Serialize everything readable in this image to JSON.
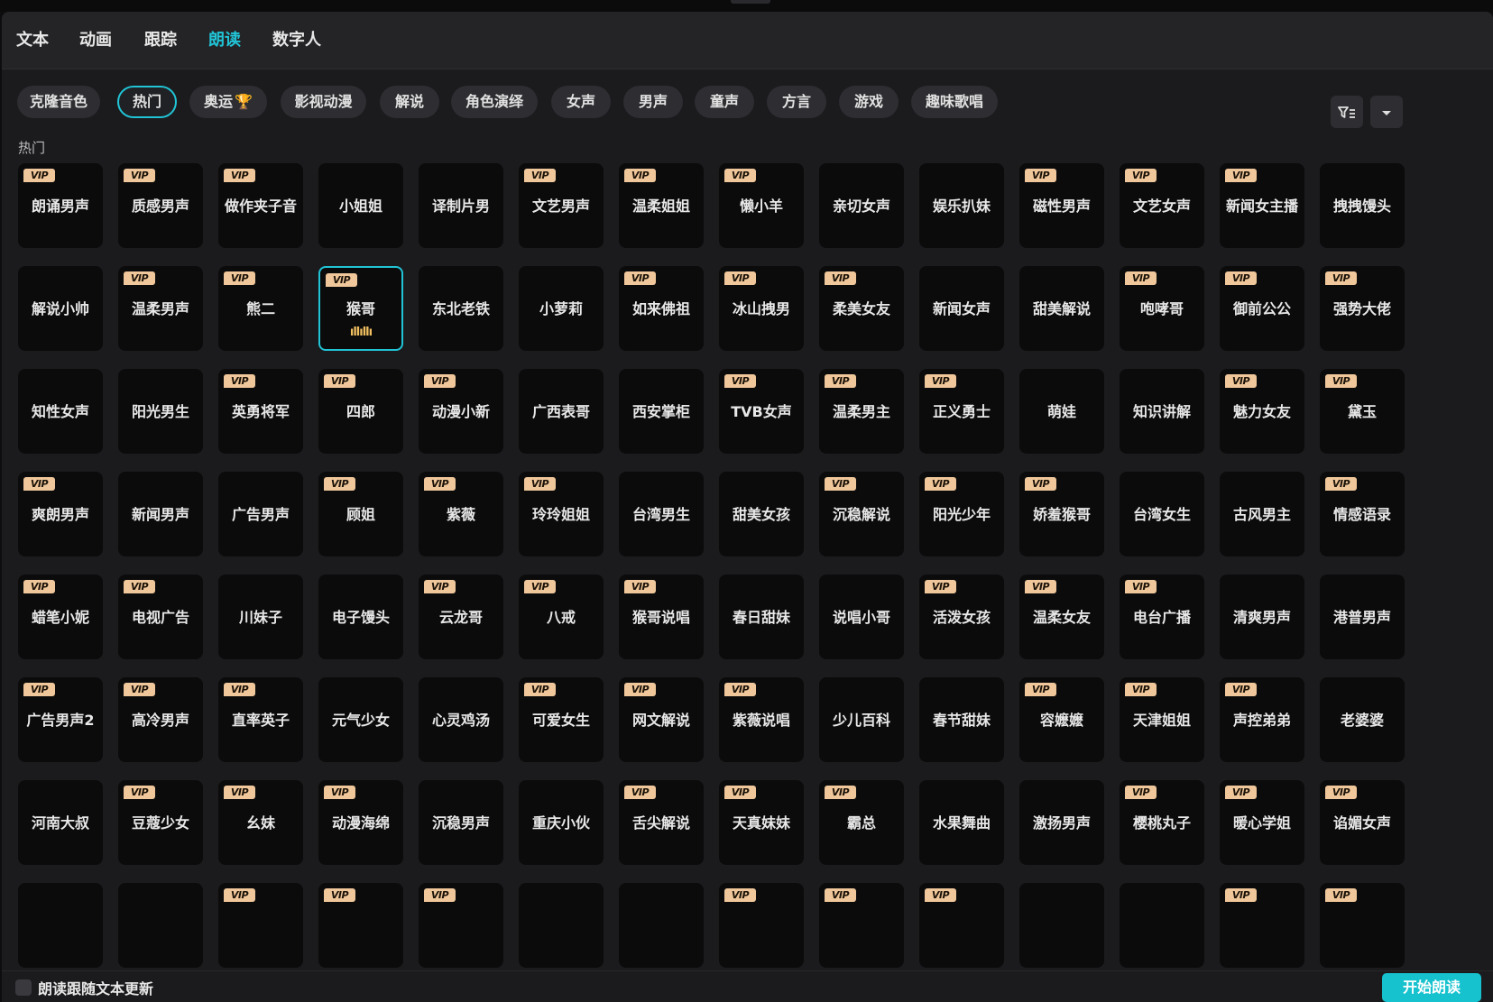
{
  "tabs": [
    "文本",
    "动画",
    "跟踪",
    "朗读",
    "数字人"
  ],
  "active_tab": "朗读",
  "filters": [
    {
      "label": "克隆音色"
    },
    {
      "label": "热门",
      "active": true
    },
    {
      "label": "奥运",
      "icon": "trophy-icon"
    },
    {
      "label": "影视动漫"
    },
    {
      "label": "解说"
    },
    {
      "label": "角色演绎"
    },
    {
      "label": "女声"
    },
    {
      "label": "男声"
    },
    {
      "label": "童声"
    },
    {
      "label": "方言"
    },
    {
      "label": "游戏"
    },
    {
      "label": "趣味歌唱"
    }
  ],
  "filter_button_icon": "filter-sort-icon",
  "expand_button_icon": "chevron-down-icon",
  "section_title": "热门",
  "vip_label": "VIP",
  "playing_wave": "ıllıllı",
  "voices": [
    [
      {
        "n": "朗诵男声",
        "v": true
      },
      {
        "n": "质感男声",
        "v": true
      },
      {
        "n": "做作夹子音",
        "v": true
      },
      {
        "n": "小姐姐",
        "v": false
      },
      {
        "n": "译制片男",
        "v": false
      },
      {
        "n": "文艺男声",
        "v": true
      },
      {
        "n": "温柔姐姐",
        "v": true
      },
      {
        "n": "懒小羊",
        "v": true
      },
      {
        "n": "亲切女声",
        "v": false
      },
      {
        "n": "娱乐扒妹",
        "v": false
      },
      {
        "n": "磁性男声",
        "v": true
      },
      {
        "n": "文艺女声",
        "v": true
      },
      {
        "n": "新闻女主播",
        "v": true
      },
      {
        "n": "拽拽馒头",
        "v": false
      }
    ],
    [
      {
        "n": "解说小帅",
        "v": false
      },
      {
        "n": "温柔男声",
        "v": true
      },
      {
        "n": "熊二",
        "v": true
      },
      {
        "n": "猴哥",
        "v": true,
        "selected": true
      },
      {
        "n": "东北老铁",
        "v": false
      },
      {
        "n": "小萝莉",
        "v": false
      },
      {
        "n": "如来佛祖",
        "v": true
      },
      {
        "n": "冰山拽男",
        "v": true
      },
      {
        "n": "柔美女友",
        "v": true
      },
      {
        "n": "新闻女声",
        "v": false
      },
      {
        "n": "甜美解说",
        "v": false
      },
      {
        "n": "咆哮哥",
        "v": true
      },
      {
        "n": "御前公公",
        "v": true
      },
      {
        "n": "强势大佬",
        "v": true
      }
    ],
    [
      {
        "n": "知性女声",
        "v": false
      },
      {
        "n": "阳光男生",
        "v": false
      },
      {
        "n": "英勇将军",
        "v": true
      },
      {
        "n": "四郎",
        "v": true
      },
      {
        "n": "动漫小新",
        "v": true
      },
      {
        "n": "广西表哥",
        "v": false
      },
      {
        "n": "西安掌柜",
        "v": false
      },
      {
        "n": "TVB女声",
        "v": true
      },
      {
        "n": "温柔男主",
        "v": true
      },
      {
        "n": "正义勇士",
        "v": true
      },
      {
        "n": "萌娃",
        "v": false
      },
      {
        "n": "知识讲解",
        "v": false
      },
      {
        "n": "魅力女友",
        "v": true
      },
      {
        "n": "黛玉",
        "v": true
      }
    ],
    [
      {
        "n": "爽朗男声",
        "v": true
      },
      {
        "n": "新闻男声",
        "v": false
      },
      {
        "n": "广告男声",
        "v": false
      },
      {
        "n": "顾姐",
        "v": true
      },
      {
        "n": "紫薇",
        "v": true
      },
      {
        "n": "玲玲姐姐",
        "v": true
      },
      {
        "n": "台湾男生",
        "v": false
      },
      {
        "n": "甜美女孩",
        "v": false
      },
      {
        "n": "沉稳解说",
        "v": true
      },
      {
        "n": "阳光少年",
        "v": true
      },
      {
        "n": "娇羞猴哥",
        "v": true
      },
      {
        "n": "台湾女生",
        "v": false
      },
      {
        "n": "古风男主",
        "v": false
      },
      {
        "n": "情感语录",
        "v": true
      }
    ],
    [
      {
        "n": "蜡笔小妮",
        "v": true
      },
      {
        "n": "电视广告",
        "v": true
      },
      {
        "n": "川妹子",
        "v": false
      },
      {
        "n": "电子馒头",
        "v": false
      },
      {
        "n": "云龙哥",
        "v": true
      },
      {
        "n": "八戒",
        "v": true
      },
      {
        "n": "猴哥说唱",
        "v": true
      },
      {
        "n": "春日甜妹",
        "v": false
      },
      {
        "n": "说唱小哥",
        "v": false
      },
      {
        "n": "活泼女孩",
        "v": true
      },
      {
        "n": "温柔女友",
        "v": true
      },
      {
        "n": "电台广播",
        "v": true
      },
      {
        "n": "清爽男声",
        "v": false
      },
      {
        "n": "港普男声",
        "v": false
      }
    ],
    [
      {
        "n": "广告男声2",
        "v": true
      },
      {
        "n": "高冷男声",
        "v": true
      },
      {
        "n": "直率英子",
        "v": true
      },
      {
        "n": "元气少女",
        "v": false
      },
      {
        "n": "心灵鸡汤",
        "v": false
      },
      {
        "n": "可爱女生",
        "v": true
      },
      {
        "n": "网文解说",
        "v": true
      },
      {
        "n": "紫薇说唱",
        "v": true
      },
      {
        "n": "少儿百科",
        "v": false
      },
      {
        "n": "春节甜妹",
        "v": false
      },
      {
        "n": "容嬷嬷",
        "v": true
      },
      {
        "n": "天津姐姐",
        "v": true
      },
      {
        "n": "声控弟弟",
        "v": true
      },
      {
        "n": "老婆婆",
        "v": false
      }
    ],
    [
      {
        "n": "河南大叔",
        "v": false
      },
      {
        "n": "豆蔻少女",
        "v": true
      },
      {
        "n": "幺妹",
        "v": true
      },
      {
        "n": "动漫海绵",
        "v": true
      },
      {
        "n": "沉稳男声",
        "v": false
      },
      {
        "n": "重庆小伙",
        "v": false
      },
      {
        "n": "舌尖解说",
        "v": true
      },
      {
        "n": "天真妹妹",
        "v": true
      },
      {
        "n": "霸总",
        "v": true
      },
      {
        "n": "水果舞曲",
        "v": false
      },
      {
        "n": "激扬男声",
        "v": false
      },
      {
        "n": "樱桃丸子",
        "v": true
      },
      {
        "n": "暖心学姐",
        "v": true
      },
      {
        "n": "谄媚女声",
        "v": true
      }
    ],
    [
      {
        "n": "",
        "v": false
      },
      {
        "n": "",
        "v": false
      },
      {
        "n": "",
        "v": true
      },
      {
        "n": "",
        "v": true
      },
      {
        "n": "",
        "v": true
      },
      {
        "n": "",
        "v": false
      },
      {
        "n": "",
        "v": false
      },
      {
        "n": "",
        "v": true
      },
      {
        "n": "",
        "v": true
      },
      {
        "n": "",
        "v": true
      },
      {
        "n": "",
        "v": false
      },
      {
        "n": "",
        "v": false
      },
      {
        "n": "",
        "v": true
      },
      {
        "n": "",
        "v": true
      }
    ]
  ],
  "footer": {
    "checkbox_label": "朗读跟随文本更新",
    "start_button": "开始朗读"
  },
  "colors": {
    "accent": "#21c4d6",
    "vip_badge": "#f0c79a",
    "start_button": "#17c2cf"
  }
}
